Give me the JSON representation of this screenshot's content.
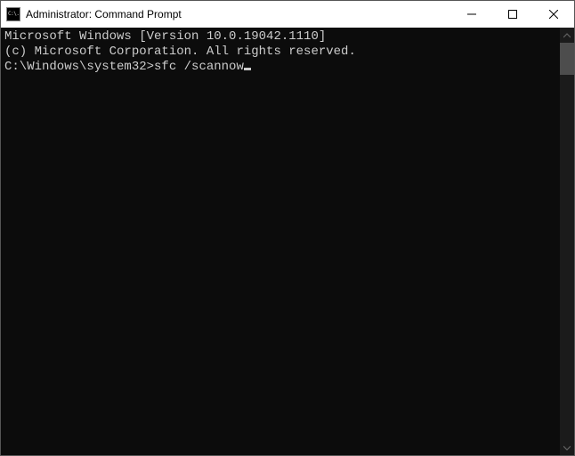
{
  "window": {
    "title": "Administrator: Command Prompt",
    "icon_glyph": "C:\\."
  },
  "console": {
    "line1": "Microsoft Windows [Version 10.0.19042.1110]",
    "line2": "(c) Microsoft Corporation. All rights reserved.",
    "blank": "",
    "prompt": "C:\\Windows\\system32>",
    "command": "sfc /scannow"
  }
}
